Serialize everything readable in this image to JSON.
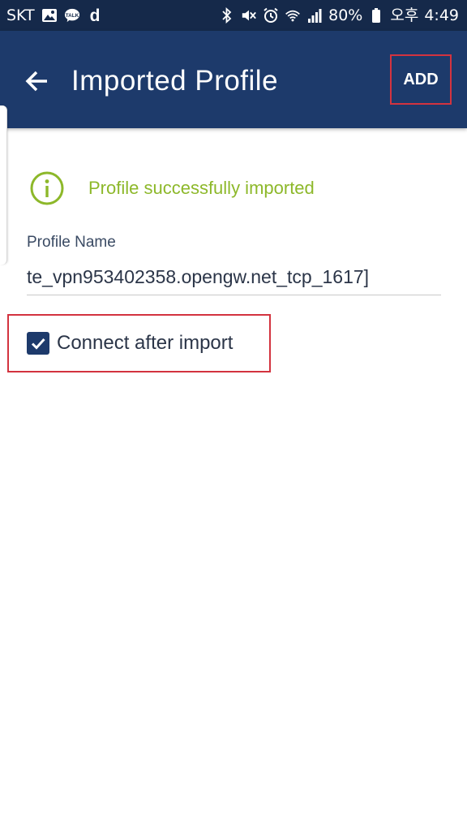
{
  "status_bar": {
    "carrier": "SKT",
    "app_icons": [
      "gallery-icon",
      "kakaotalk-icon",
      "d-app-icon"
    ],
    "talk_badge": "TALK",
    "d_app_letter": "d",
    "system_icons": [
      "bluetooth-icon",
      "mute-icon",
      "alarm-icon",
      "wifi-icon",
      "signal-icon",
      "battery-icon"
    ],
    "battery": "80%",
    "ampm": "오후",
    "time": "4:49"
  },
  "app_bar": {
    "title": "Imported Profile",
    "add_label": "ADD",
    "background": "#1d3a6b"
  },
  "info": {
    "message": "Profile successfully imported",
    "color": "#8db82a"
  },
  "profile_name": {
    "label": "Profile Name",
    "value": "te_vpn953402358.opengw.net_tcp_1617]"
  },
  "connect_option": {
    "label": "Connect after import",
    "checked": true
  },
  "highlight_color": "#d3333f"
}
